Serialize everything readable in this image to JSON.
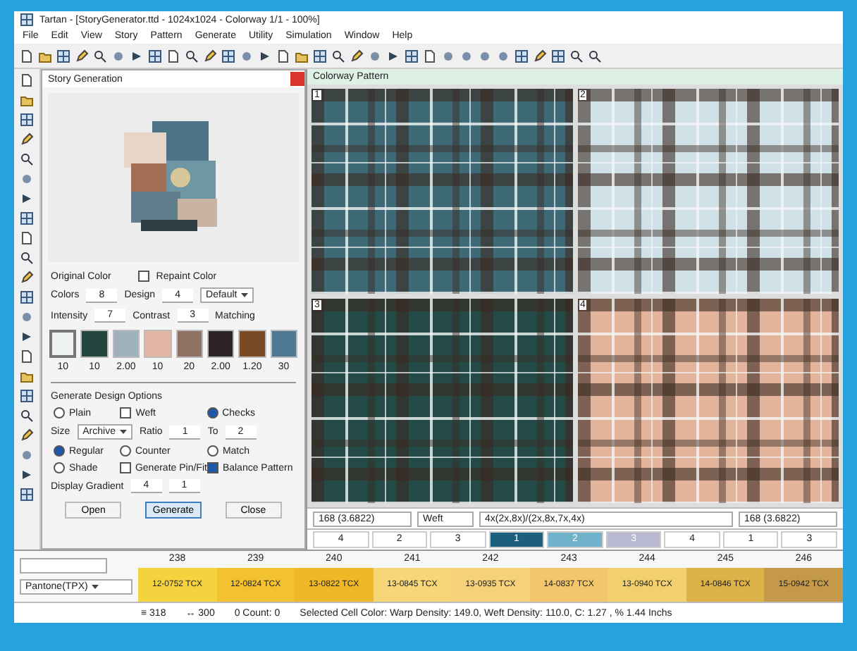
{
  "window": {
    "title": "Tartan - [StoryGenerator.ttd - 1024x1024 - Colorway 1/1 - 100%]"
  },
  "menu": [
    "File",
    "Edit",
    "View",
    "Story",
    "Pattern",
    "Generate",
    "Utility",
    "Simulation",
    "Window",
    "Help"
  ],
  "dialog": {
    "title": "Story Generation",
    "original_color": "Original Color",
    "repaint": {
      "label": "Repaint Color",
      "checked": false
    },
    "fields": [
      {
        "label": "Colors",
        "value": "8"
      },
      {
        "label": "Design",
        "value": "4"
      },
      {
        "label": "Intensity",
        "value": "7"
      },
      {
        "label": "Contrast",
        "value": "3"
      }
    ],
    "preset": "Default",
    "matching": "Matching",
    "swatches": [
      {
        "color": "#eef3f1",
        "value": "10",
        "selected": true
      },
      {
        "color": "#23463f",
        "value": "10",
        "selected": false
      },
      {
        "color": "#9fb2bb",
        "value": "2.00",
        "selected": false
      },
      {
        "color": "#e2b7a4",
        "value": "10",
        "selected": false
      },
      {
        "color": "#8f7261",
        "value": "20",
        "selected": false
      },
      {
        "color": "#2a2224",
        "value": "2.00",
        "selected": false
      },
      {
        "color": "#7a4a25",
        "value": "1.20",
        "selected": false
      },
      {
        "color": "#4f7895",
        "value": "30",
        "selected": false
      }
    ],
    "options_title": "Generate Design Options",
    "options_top": [
      {
        "kind": "radio",
        "label": "Plain",
        "checked": false
      },
      {
        "kind": "checkbox",
        "label": "Weft",
        "checked": false
      },
      {
        "kind": "radio",
        "label": "Checks",
        "checked": true
      }
    ],
    "size": {
      "label": "Size",
      "value": "Archive"
    },
    "ratio": {
      "label": "Ratio",
      "value": "1"
    },
    "to": {
      "label": "To",
      "value": "2"
    },
    "options": [
      {
        "kind": "radio",
        "label": "Regular",
        "checked": true
      },
      {
        "kind": "radio",
        "label": "Counter",
        "checked": false
      },
      {
        "kind": "radio",
        "label": "Match",
        "checked": false
      },
      {
        "kind": "radio",
        "label": "Shade",
        "checked": false
      },
      {
        "kind": "checkbox",
        "label": "Generate Pin/Fit",
        "checked": false
      },
      {
        "kind": "checkbox",
        "label": "Balance Pattern",
        "checked": true
      }
    ],
    "gradient": {
      "label": "Display Gradient",
      "a": "4",
      "b": "1"
    },
    "buttons": [
      {
        "label": "Open",
        "default": false
      },
      {
        "label": "Generate",
        "default": true
      },
      {
        "label": "Close",
        "default": false
      }
    ]
  },
  "document": {
    "title": "Colorway Pattern",
    "tiles": [
      {
        "number": "1",
        "color": "#3d6a76"
      },
      {
        "number": "2",
        "color": "#cfe0e6"
      },
      {
        "number": "3",
        "color": "#234a47"
      },
      {
        "number": "4",
        "color": "#e2b49c"
      }
    ],
    "info": [
      "168 (3.6822)",
      "Weft",
      "4x(2x,8x)/(2x,8x,7x,4x)",
      "168 (3.6822)"
    ],
    "sequence": [
      {
        "label": "4"
      },
      {
        "label": "2"
      },
      {
        "label": "3"
      },
      {
        "label": "1",
        "color": "#1e5f80"
      },
      {
        "label": "2",
        "color": "#6fb2c9"
      },
      {
        "label": "3",
        "color": "#b9b9d3"
      },
      {
        "label": "4"
      },
      {
        "label": "1"
      },
      {
        "label": "3"
      }
    ]
  },
  "palette": {
    "library": "Pantone(TPX)",
    "columns": [
      {
        "number": "238",
        "code": "12-0752 TCX",
        "color": "#f5d33f"
      },
      {
        "number": "239",
        "code": "12-0824 TCX",
        "color": "#f2c230"
      },
      {
        "number": "240",
        "code": "13-0822 TCX",
        "color": "#f0b826"
      },
      {
        "number": "241",
        "code": "13-0845 TCX",
        "color": "#f6d677"
      },
      {
        "number": "242",
        "code": "13-0935 TCX",
        "color": "#f5d17a"
      },
      {
        "number": "243",
        "code": "14-0837 TCX",
        "color": "#f4c66b"
      },
      {
        "number": "244",
        "code": "13-0940 TCX",
        "color": "#f3d06e"
      },
      {
        "number": "245",
        "code": "14-0846 TCX",
        "color": "#dcb249"
      },
      {
        "number": "246",
        "code": "15-0942 TCX",
        "color": "#c49a4a"
      }
    ]
  },
  "status": [
    "≡ 318",
    "↔ 300",
    "0 Count: 0",
    "Selected Cell Color: Warp Density: 149.0, Weft Density: 110.0, C: 1.27 , % 1.44 Inchs"
  ]
}
